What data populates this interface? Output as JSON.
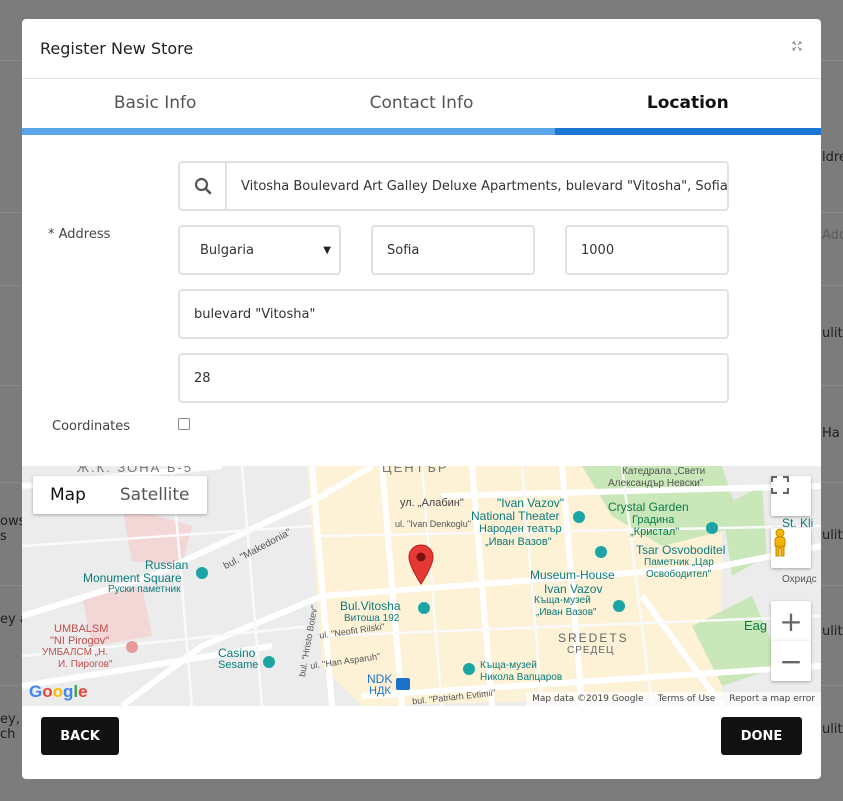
{
  "background": {
    "cells": [
      "ldre",
      "Addr",
      "ulit",
      "На",
      "ows",
      "s",
      "ulit",
      "ey a",
      "ulit",
      "ey,",
      "ch",
      "ulit"
    ]
  },
  "modal": {
    "title": "Register New Store",
    "collapse_icon": "collapse-arrows-icon"
  },
  "tabs": [
    {
      "label": "Basic Info",
      "active": false
    },
    {
      "label": "Contact Info",
      "active": false
    },
    {
      "label": "Location",
      "active": true
    }
  ],
  "form": {
    "address_label": "* Address",
    "search_value": "Vitosha Boulevard Art Galley Deluxe Apartments, bulevard \"Vitosha\", Sofia, B",
    "country": "Bulgaria",
    "city": "Sofia",
    "postal_code": "1000",
    "street": "bulevard \"Vitosha\"",
    "number": "28",
    "coordinates_label": "Coordinates",
    "coordinates_checked": false
  },
  "map": {
    "type_options": [
      "Map",
      "Satellite"
    ],
    "selected_type": "Map",
    "labels": {
      "district_north": "Ж.К. ЗОНА Б-5",
      "center": "ЦЕНТЪР",
      "alabin": "ул. „Алабин\"",
      "ivan_denkoglu": "ul. \"Ivan Denkoglu\"",
      "ivan_vazov_theater": "\"Ivan Vazov\"",
      "national_theater": "National Theater",
      "theater_bg1": "Народен театър",
      "theater_bg2": "„Иван Вазов\"",
      "cathedral_bg1": "Катедрала „Свети",
      "cathedral_bg2": "Александър Невски\"",
      "crystal_garden": "Crystal Garden",
      "crystal_bg1": "Градина",
      "crystal_bg2": "„Кристал\"",
      "tsar": "Tsar Osvoboditel",
      "tsar_bg1": "Паметник „Цар",
      "tsar_bg2": "Освободител\"",
      "st_kl": "St. Kli",
      "museum": "Museum-House",
      "museum2": "Ivan Vazov",
      "museum_bg1": "Къща-музей",
      "museum_bg2": "„Иван Вазов\"",
      "russian": "Russian",
      "monument_sq": "Monument Square",
      "russian_bg": "Руски паметник",
      "bul_vitosha": "Bul.Vitosha",
      "vitosha_192": "Витоша 192",
      "sredets": "SREDETS",
      "sredets_bg": "СРЕДЕЦ",
      "umbalsm": "UMBALSM",
      "pirogov": "\"NI Pirogov\"",
      "umbalsm_bg": "УМБАЛСМ „Н.",
      "pirogov_bg": "И. Пирогов\"",
      "casino": "Casino",
      "sesame": "Sesame",
      "kashta": "Къща-музей",
      "nikola": "Никола Вапцаров",
      "ndk": "NDK",
      "ndk_bg": "НДК",
      "makedonia": "bul. \"Makedonia\"",
      "hristo_botev": "bul. \"Hristo Botev\"",
      "han_asparuh": "ul. \"Han Asparuh\"",
      "neofit": "ul. \"Neofit Rilski\"",
      "patriarh": "bul. \"Patriarh Evtimii\"",
      "eag": "Eag",
      "ohrid": "Охридс"
    },
    "footer": {
      "map_data": "Map data ©2019 Google",
      "terms": "Terms of Use",
      "report": "Report a map error"
    },
    "google_logo": "Google"
  },
  "footer": {
    "back_label": "BACK",
    "done_label": "DONE"
  },
  "colors": {
    "accent": "#1976d2",
    "tab_bar": "#5aa6e8",
    "marker": "#e53935",
    "button": "#111111"
  }
}
